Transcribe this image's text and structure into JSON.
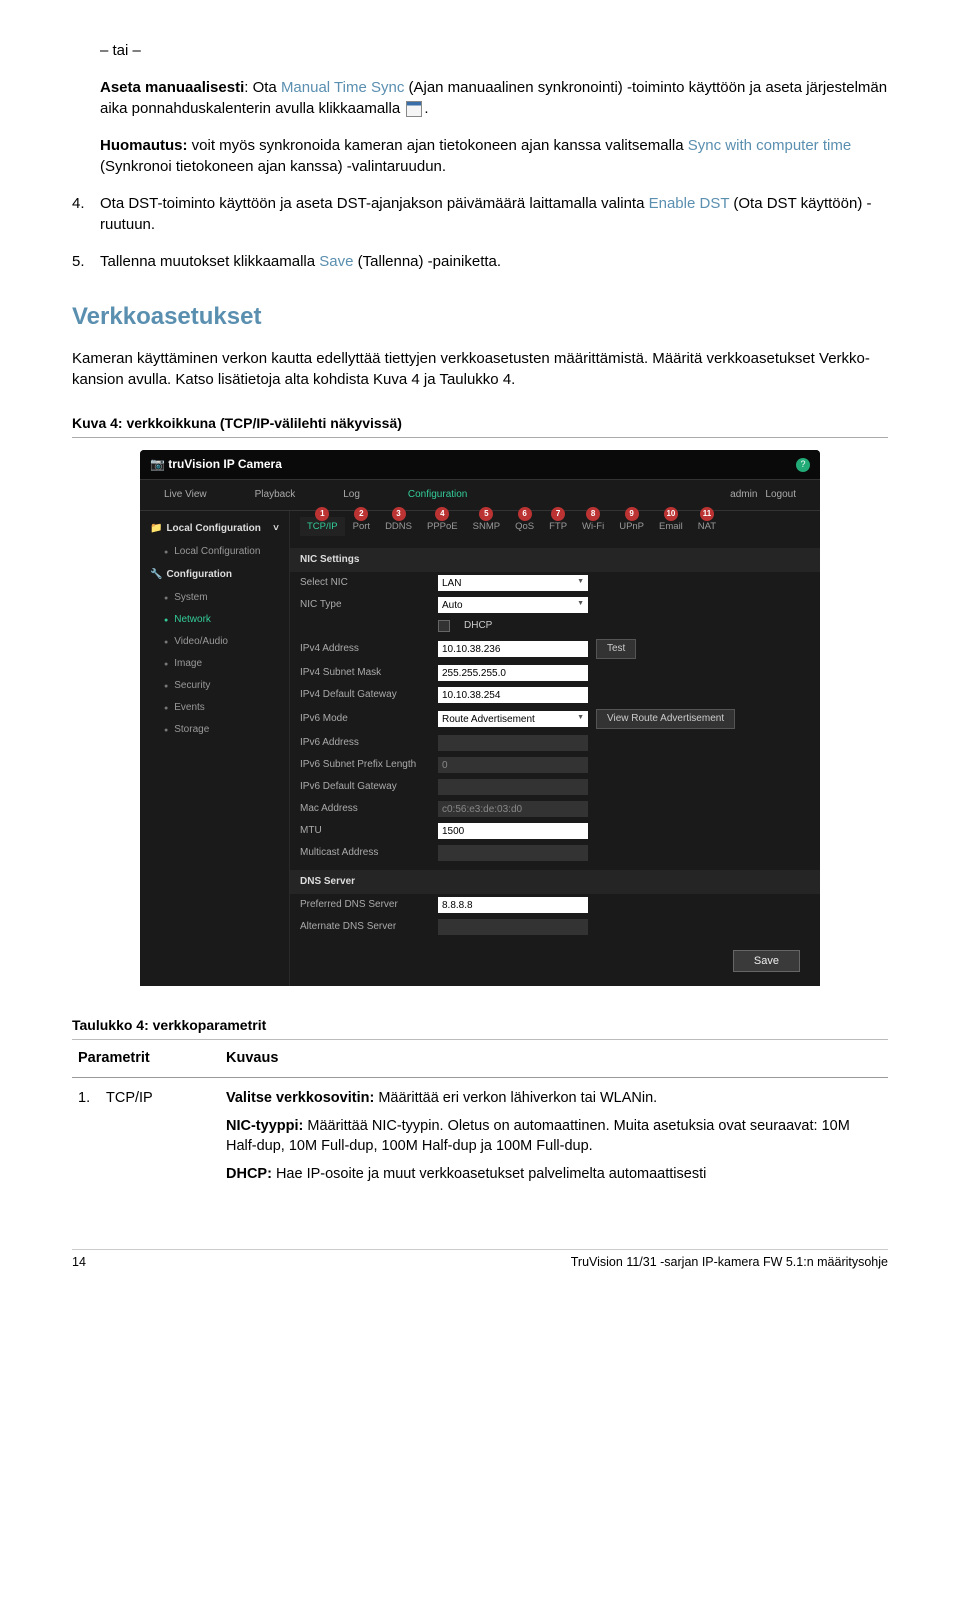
{
  "intro": {
    "tai": "– tai –",
    "aseta_label": "Aseta manuaalisesti",
    "aseta_rest1": ": Ota ",
    "aseta_colored": "Manual Time Sync",
    "aseta_rest2": " (Ajan manuaalinen synkronointi) -toiminto käyttöön ja aseta järjestelmän aika ponnahduskalenterin avulla klikkaamalla ",
    "huom_label": "Huomautus:",
    "huom_rest1": " voit myös synkronoida kameran ajan tietokoneen ajan kanssa valitsemalla ",
    "huom_colored": "Sync with computer time",
    "huom_rest2": " (Synkronoi tietokoneen ajan kanssa) -valintaruudun."
  },
  "step4": {
    "num": "4.",
    "pre": "Ota DST-toiminto käyttöön ja aseta DST-ajanjakson päivämäärä laittamalla valinta ",
    "colored": "Enable DST",
    "post": " (Ota DST käyttöön) -ruutuun."
  },
  "step5": {
    "num": "5.",
    "pre": "Tallenna muutokset klikkaamalla ",
    "colored": "Save",
    "post": " (Tallenna) -painiketta."
  },
  "section": {
    "title": "Verkkoasetukset",
    "p1": "Kameran käyttäminen verkon kautta edellyttää tiettyjen verkkoasetusten määrittämistä. Määritä verkkoasetukset Verkko-kansion avulla. Katso lisätietoja alta kohdista Kuva 4 ja Taulukko 4.",
    "figcap": "Kuva 4: verkkoikkuna (TCP/IP-välilehti näkyvissä)"
  },
  "shot": {
    "brand": "truVision IP Camera",
    "admin": "admin",
    "logout": "Logout",
    "nav": {
      "live": "Live View",
      "playback": "Playback",
      "log": "Log",
      "config": "Configuration"
    },
    "side": {
      "localgrp": "Local Configuration",
      "local": "Local Configuration",
      "confgrp": "Configuration",
      "items": [
        "System",
        "Network",
        "Video/Audio",
        "Image",
        "Security",
        "Events",
        "Storage"
      ]
    },
    "tabs": [
      "TCP/IP",
      "Port",
      "DDNS",
      "PPPoE",
      "SNMP",
      "QoS",
      "FTP",
      "Wi-Fi",
      "UPnP",
      "Email",
      "NAT"
    ],
    "badge_nums": [
      "1",
      "2",
      "3",
      "4",
      "5",
      "6",
      "7",
      "8",
      "9",
      "10",
      "11"
    ],
    "nic_title": "NIC Settings",
    "selectnic_l": "Select NIC",
    "selectnic_v": "LAN",
    "nictype_l": "NIC Type",
    "nictype_v": "Auto",
    "dhcp": "DHCP",
    "ipv4_l": "IPv4 Address",
    "ipv4_v": "10.10.38.236",
    "test": "Test",
    "mask_l": "IPv4 Subnet Mask",
    "mask_v": "255.255.255.0",
    "gw_l": "IPv4 Default Gateway",
    "gw_v": "10.10.38.254",
    "ipv6m_l": "IPv6 Mode",
    "ipv6m_v": "Route Advertisement",
    "viewroute": "View Route Advertisement",
    "ipv6a_l": "IPv6 Address",
    "ipv6p_l": "IPv6 Subnet Prefix Length",
    "ipv6p_v": "0",
    "ipv6g_l": "IPv6 Default Gateway",
    "mac_l": "Mac Address",
    "mac_v": "c0:56:e3:de:03:d0",
    "mtu_l": "MTU",
    "mtu_v": "1500",
    "multi_l": "Multicast Address",
    "dns_title": "DNS Server",
    "pdns_l": "Preferred DNS Server",
    "pdns_v": "8.8.8.8",
    "adns_l": "Alternate DNS Server",
    "save": "Save"
  },
  "table": {
    "title": "Taulukko 4: verkkoparametrit",
    "h1": "Parametrit",
    "h2": "Kuvaus",
    "r1num": "1.",
    "r1name": "TCP/IP",
    "r1_a_b": "Valitse verkkosovitin:",
    "r1_a_t": " Määrittää eri verkon lähiverkon tai WLANin.",
    "r1_b_b": "NIC-tyyppi:",
    "r1_b_t": " Määrittää NIC-tyypin. Oletus on automaattinen. Muita asetuksia ovat seuraavat: 10M Half-dup, 10M Full-dup, 100M Half-dup ja 100M Full-dup.",
    "r1_c_b": "DHCP:",
    "r1_c_t": " Hae IP-osoite ja muut verkkoasetukset palvelimelta automaattisesti"
  },
  "footer": {
    "page": "14",
    "doc": "TruVision 11/31 -sarjan IP-kamera FW 5.1:n määritysohje"
  }
}
